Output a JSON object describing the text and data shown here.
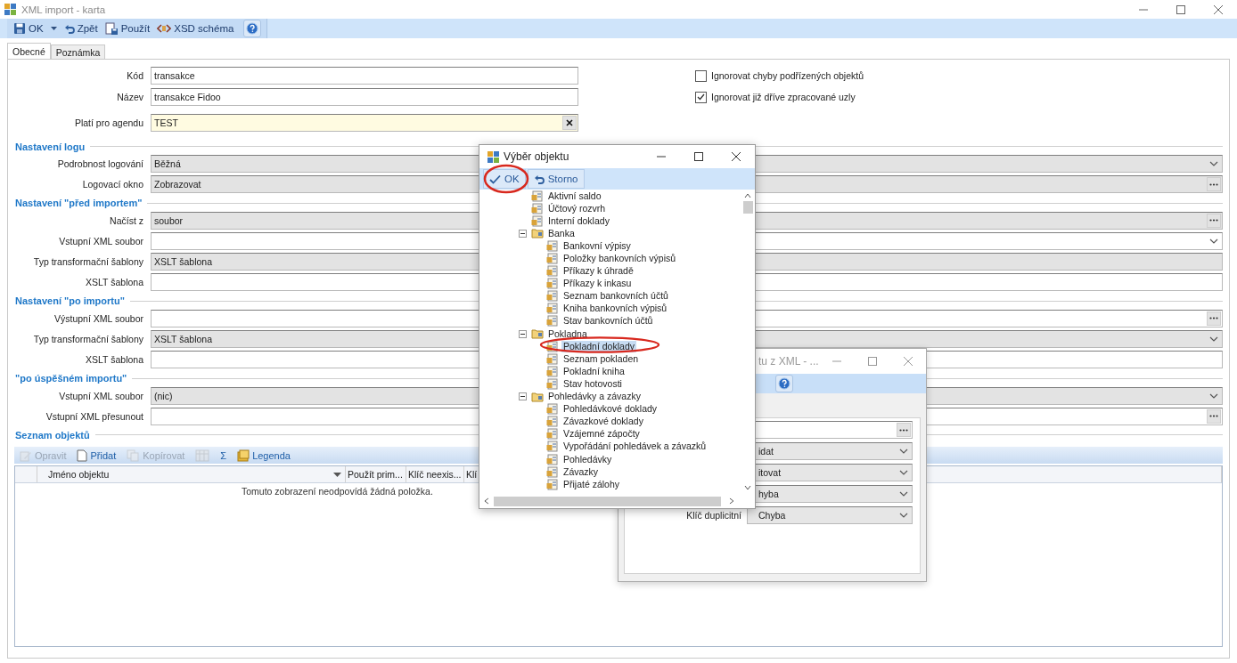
{
  "window": {
    "title": "XML import - karta"
  },
  "toolbar": [
    {
      "kind": "save",
      "label": "OK",
      "menu": true
    },
    {
      "kind": "undo",
      "label": "Zpět",
      "menu": false
    },
    {
      "kind": "apply",
      "label": "Použít",
      "menu": false
    },
    {
      "kind": "schema",
      "label": "XSD schéma",
      "menu": false
    },
    {
      "kind": "help"
    }
  ],
  "tabs": [
    {
      "label": "Obecné",
      "selected": true
    },
    {
      "label": "Poznámka",
      "selected": false
    }
  ],
  "fields": [
    {
      "label": "Kód",
      "value": "transakce",
      "kind": "text"
    },
    {
      "label": "Název",
      "value": "transakce Fidoo",
      "kind": "text"
    },
    {
      "label": "Platí pro agendu",
      "value": "TEST",
      "kind": "lookup"
    }
  ],
  "options": [
    {
      "label": "Ignorovat chyby podřízených objektů",
      "checked": false
    },
    {
      "label": "Ignorovat již dříve zpracované uzly",
      "checked": true
    }
  ],
  "sections": [
    {
      "title": "Nastavení logu",
      "rows": [
        {
          "label": "Podrobnost logování",
          "value": "Běžná",
          "kind": "combo",
          "disabled": true
        },
        {
          "label": "Logovací okno",
          "value": "Zobrazovat",
          "kind": "browse",
          "disabled": true
        }
      ]
    },
    {
      "title": "Nastavení \"před importem\"",
      "rows": [
        {
          "label": "Načíst z",
          "value": "soubor",
          "kind": "browse",
          "disabled": true
        },
        {
          "label": "Vstupní XML soubor",
          "kind": "combo",
          "disabled": false
        },
        {
          "label": "Typ transformační šablony",
          "value": "XSLT šablona",
          "kind": "text",
          "disabled": true
        },
        {
          "label": "XSLT šablona",
          "kind": "text",
          "disabled": false
        }
      ]
    },
    {
      "title": "Nastavení \"po importu\"",
      "rows": [
        {
          "label": "Výstupní XML soubor",
          "kind": "browse",
          "disabled": false
        },
        {
          "label": "Typ transformační šablony",
          "value": "XSLT šablona",
          "kind": "combo",
          "disabled": true
        },
        {
          "label": "XSLT šablona",
          "kind": "text",
          "disabled": false
        }
      ]
    },
    {
      "title": "\"po úspěšném importu\"",
      "rows": [
        {
          "label": "Vstupní XML soubor",
          "value": "(nic)",
          "kind": "combo",
          "disabled": true
        },
        {
          "label": "Vstupní XML přesunout",
          "kind": "browse",
          "disabled": false
        }
      ]
    }
  ],
  "objects": {
    "title": "Seznam objektů",
    "toolbar": [
      {
        "kind": "edit",
        "label": "Opravit",
        "disabled": true
      },
      {
        "kind": "add",
        "label": "Přidat",
        "disabled": false
      },
      {
        "kind": "copy",
        "label": "Kopírovat",
        "disabled": true
      },
      {
        "kind": "columns",
        "disabled": true
      },
      {
        "kind": "sum",
        "label": "Σ",
        "disabled": false
      },
      {
        "kind": "legend",
        "label": "Legenda",
        "disabled": false
      }
    ],
    "columns": [
      {
        "label": "Jméno objektu",
        "filter": true
      },
      {
        "label": "Použít prim...",
        "filter": false
      },
      {
        "label": "Klíč neexis...",
        "filter": false
      },
      {
        "label": "Klí",
        "filter": false
      }
    ],
    "empty_message": "Tomuto zobrazení neodpovídá žádná položka."
  },
  "object_dialog": {
    "title": "Výběr objektu",
    "buttons": [
      {
        "kind": "ok",
        "label": "OK"
      },
      {
        "kind": "cancel",
        "label": "Storno"
      }
    ],
    "tree": [
      {
        "label": "Aktivní saldo",
        "selected": false
      },
      {
        "label": "Účtový rozvrh",
        "selected": false
      },
      {
        "label": "Interní doklady",
        "selected": false
      },
      {
        "label": "Banka",
        "selected": false,
        "expanded": true,
        "children": [
          {
            "label": "Bankovní výpisy",
            "selected": false
          },
          {
            "label": "Položky bankovních výpisů",
            "selected": false
          },
          {
            "label": "Příkazy k úhradě",
            "selected": false
          },
          {
            "label": "Příkazy k inkasu",
            "selected": false
          },
          {
            "label": "Seznam bankovních účtů",
            "selected": false
          },
          {
            "label": "Kniha bankovních výpisů",
            "selected": false
          },
          {
            "label": "Stav bankovních účtů",
            "selected": false
          }
        ]
      },
      {
        "label": "Pokladna",
        "selected": false,
        "expanded": true,
        "children": [
          {
            "label": "Pokladní doklady",
            "selected": true
          },
          {
            "label": "Seznam pokladen",
            "selected": false
          },
          {
            "label": "Pokladní kniha",
            "selected": false
          },
          {
            "label": "Stav hotovosti",
            "selected": false
          }
        ]
      },
      {
        "label": "Pohledávky a závazky",
        "selected": false,
        "expanded": true,
        "children": [
          {
            "label": "Pohledávkové doklady",
            "selected": false
          },
          {
            "label": "Závazkové doklady",
            "selected": false
          },
          {
            "label": "Vzájemné zápočty",
            "selected": false
          },
          {
            "label": "Vypořádání pohledávek a závazků",
            "selected": false
          },
          {
            "label": "Pohledávky",
            "selected": false
          },
          {
            "label": "Závazky",
            "selected": false
          },
          {
            "label": "Přijaté zálohy",
            "selected": false
          }
        ]
      }
    ]
  },
  "back_dialog": {
    "title": "tu z XML - ...",
    "rows": [
      {
        "kind": "browse"
      },
      {
        "kind": "combo",
        "value": "idat"
      },
      {
        "kind": "combo",
        "value": "itovat"
      },
      {
        "kind": "combo",
        "value": "hyba"
      },
      {
        "kind": "combo",
        "label": "Klíč duplicitní",
        "value": "Chyba"
      }
    ]
  }
}
